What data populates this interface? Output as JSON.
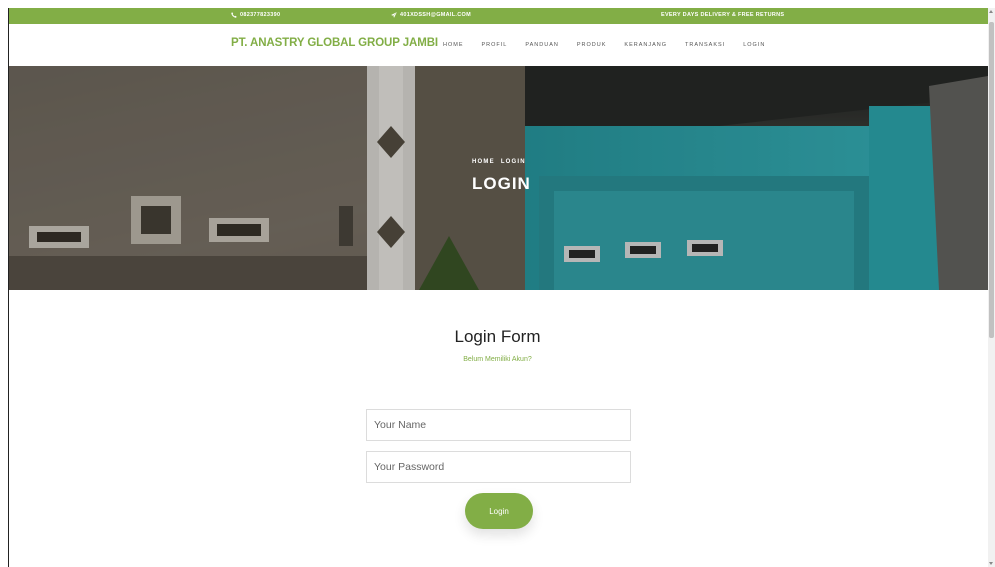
{
  "topbar": {
    "phone": "082377823390",
    "email": "401XDSSH@GMAIL.COM",
    "promo": "EVERY DAYS DELIVERY & FREE RETURNS"
  },
  "brand": "PT. ANASTRY GLOBAL GROUP JAMBI",
  "nav": [
    "HOME",
    "PROFIL",
    "PANDUAN",
    "PRODUK",
    "KERANJANG",
    "TRANSAKSI",
    "LOGIN"
  ],
  "hero": {
    "breadcrumb_home": "HOME",
    "breadcrumb_current": "LOGIN",
    "title": "LOGIN"
  },
  "form": {
    "title": "Login Form",
    "register_link": "Belum Memiliki Akun?",
    "name_placeholder": "Your Name",
    "password_placeholder": "Your Password",
    "submit_label": "Login"
  },
  "colors": {
    "accent": "#82ae46",
    "teal_wall": "#2fb0b8"
  },
  "icons": [
    "phone-icon",
    "paper-plane-icon"
  ]
}
